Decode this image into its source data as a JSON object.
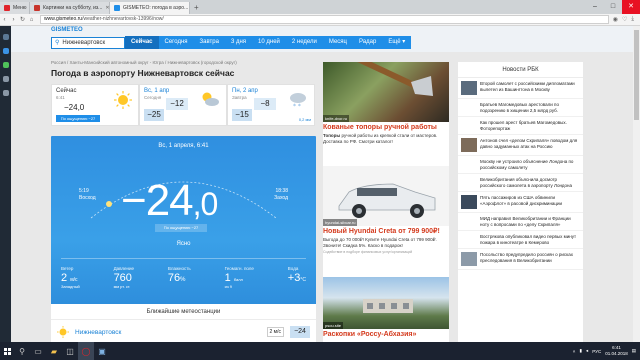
{
  "browser": {
    "tabs": [
      {
        "label": "Меню",
        "color": "#e0242b",
        "active": false
      },
      {
        "label": "Картинки на субботу, из...",
        "color": "#c8342b",
        "active": false
      },
      {
        "label": "GISMETEO: погода в аэро...",
        "color": "#1f8ee8",
        "active": true
      }
    ],
    "new_tab": "+",
    "url_domain": "www.gismeteo.ru",
    "url_path": "/weather-nizhnevartovsk-13996/now/",
    "controls": [
      "–",
      "□",
      "✕"
    ]
  },
  "site": {
    "logo": "GISMETEO",
    "search_value": "Нижневартовск",
    "menu": [
      "Сейчас",
      "Сегодня",
      "Завтра",
      "3 дня",
      "10 дней",
      "2 недели",
      "Месяц",
      "Радар",
      "Ещё ▾"
    ],
    "active_menu": "Сейчас"
  },
  "page": {
    "breadcrumbs": "Россия  /  Ханты-Мансийский автономный округ - Югра  /  Нижневартовск (городской округ)",
    "title": "Погода в аэропорту Нижневартовск сейчас"
  },
  "days": [
    {
      "name": "Сейчас",
      "date": "6:41",
      "temp": "−24,0",
      "feels": "По ощущению −27"
    },
    {
      "name": "Вс, 1 апр",
      "date": "Сегодня",
      "lo": "−25",
      "hi": "−12"
    },
    {
      "name": "Пн, 2 апр",
      "date": "Завтра",
      "lo": "−15",
      "hi": "−8",
      "precip": "0,2 мм"
    }
  ],
  "current": {
    "date": "Вс, 1 апреля, 6:41",
    "sunrise_time": "5:19",
    "sunrise_label": "Восход",
    "sunset_time": "18:38",
    "sunset_label": "Заход",
    "temp_int": "−24",
    "temp_frac": ",0",
    "feels": "По ощущению −27",
    "condition": "Ясно",
    "params": [
      {
        "label": "Ветер",
        "value": "2",
        "unit": "м/с",
        "sub": "Западный"
      },
      {
        "label": "Давление",
        "value": "760",
        "unit": "мм рт. ст.",
        "sub": ""
      },
      {
        "label": "Влажность",
        "value": "76",
        "unit": "%",
        "sub": ""
      },
      {
        "label": "Геомагн. поле",
        "value": "1",
        "unit": "балл",
        "sub": "из 9"
      },
      {
        "label": "Вода",
        "value": "+3",
        "unit": "°C",
        "sub": ""
      }
    ]
  },
  "nearest": {
    "title": "Ближайшие метеостанции",
    "city": "Нижневартовск",
    "wind": "2 м/с",
    "temp": "−24"
  },
  "ads": [
    {
      "source": "knife-dvor.ru",
      "title": "Кованые топоры ручной работы",
      "text_bold": "Топоры",
      "text": " ручной работы из крепкой стали от мастеров. Доставка по РФ. Смотри каталог!"
    },
    {
      "source": "hyundai-sibcar.ru",
      "title": "Новый Hyundai Creta от 799 900₽!",
      "text": "Выгода до 70 000₽! Купите Hyundai Creta от 799 900₽. Звоните! Скидка 5%. Каско в подарок!",
      "note": "Содействие в подборе финансовых услуг/организаций"
    },
    {
      "source": "psou.site",
      "title": "Раскопки «Россу-Абхазия»",
      "text": ""
    }
  ],
  "news": {
    "title": "Новости РБК",
    "items": [
      {
        "text": "Второй самолет с российскими дипломатами вылетел из Вашингтона в Москву",
        "thumb": "#5a6b7d"
      },
      {
        "text": "Братьев Магомедовых арестовали по подозрению в хищении 2,5 млрд руб.",
        "thumb": ""
      },
      {
        "text": "Как прошел арест братьев Магомедовых. Фоторепортаж",
        "thumb": ""
      },
      {
        "text": "Антонов счел «делом Скрипаля» поводом для давно задуманных атак на Россию",
        "thumb": "#7d6b5a"
      },
      {
        "text": "Москву не устроило объяснение Лондона по российскому самолету",
        "thumb": ""
      },
      {
        "text": "Великобритания объяснила досмотр российского самолета в аэропорту Лондона",
        "thumb": ""
      },
      {
        "text": "Пять пассажиров из США обвинили «Аэрофлот» в расовой дискриминации",
        "thumb": "#3b4a5c"
      },
      {
        "text": "МИД направил Великобритании и Франции ноту с вопросами по «делу Скрипаля»",
        "thumb": ""
      },
      {
        "text": "Вострякова опубликовал видео первых минут пожара в кинотеатре в Кемерово",
        "thumb": ""
      },
      {
        "text": "Посольство предупредило россиян о рисках преследования в Великобритании",
        "thumb": "#8c9aa8"
      }
    ]
  },
  "taskbar": {
    "lang": "РУС",
    "time": "6:41",
    "date": "01.04.2018"
  }
}
